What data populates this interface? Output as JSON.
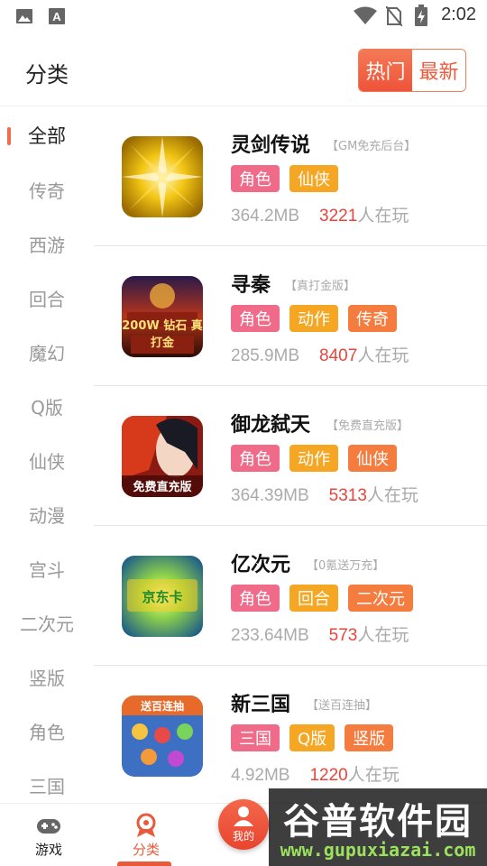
{
  "status_bar": {
    "time": "2:02",
    "icons": [
      "image-icon",
      "text-a-icon",
      "wifi-icon",
      "no-sim-icon",
      "battery-charging-icon"
    ]
  },
  "header": {
    "title": "分类",
    "toggle": {
      "hot_label": "热门",
      "new_label": "最新",
      "selected": "热门"
    }
  },
  "sidebar": {
    "items": [
      {
        "label": "全部",
        "active": true
      },
      {
        "label": "传奇",
        "active": false
      },
      {
        "label": "西游",
        "active": false
      },
      {
        "label": "回合",
        "active": false
      },
      {
        "label": "魔幻",
        "active": false
      },
      {
        "label": "Q版",
        "active": false
      },
      {
        "label": "仙侠",
        "active": false
      },
      {
        "label": "动漫",
        "active": false
      },
      {
        "label": "宫斗",
        "active": false
      },
      {
        "label": "二次元",
        "active": false
      },
      {
        "label": "竖版",
        "active": false
      },
      {
        "label": "角色",
        "active": false
      },
      {
        "label": "三国",
        "active": false
      }
    ]
  },
  "games": [
    {
      "name": "灵剑传说",
      "tagline": "【GM免充后台】",
      "tags": [
        "角色",
        "仙侠"
      ],
      "size": "364.2MB",
      "players": "3221",
      "players_suffix": "人在玩",
      "icon_text": ""
    },
    {
      "name": "寻秦",
      "tagline": "【真打金版】",
      "tags": [
        "角色",
        "动作",
        "传奇"
      ],
      "size": "285.9MB",
      "players": "8407",
      "players_suffix": "人在玩",
      "icon_text": "200W 钻石 真打金"
    },
    {
      "name": "御龙弑天",
      "tagline": "【免费直充版】",
      "tags": [
        "角色",
        "动作",
        "仙侠"
      ],
      "size": "364.39MB",
      "players": "5313",
      "players_suffix": "人在玩",
      "icon_text": "免费直充版"
    },
    {
      "name": "亿次元",
      "tagline": "【0氪送万充】",
      "tags": [
        "角色",
        "回合",
        "二次元"
      ],
      "size": "233.64MB",
      "players": "573",
      "players_suffix": "人在玩",
      "icon_text": "京东卡"
    },
    {
      "name": "新三国",
      "tagline": "【送百连抽】",
      "tags": [
        "三国",
        "Q版",
        "竖版"
      ],
      "size": "4.92MB",
      "players": "1220",
      "players_suffix": "人在玩",
      "icon_text": "送百连抽"
    }
  ],
  "bottom_nav": {
    "items": [
      {
        "label": "游戏",
        "icon": "gamepad-icon",
        "active": false
      },
      {
        "label": "分类",
        "icon": "category-icon",
        "active": true
      },
      {
        "label": "我的",
        "icon": "user-icon",
        "active": false
      }
    ]
  },
  "watermark": {
    "title": "谷普软件园",
    "url": "www.gupuxiazai.com"
  },
  "colors": {
    "accent": "#ee5a3c",
    "count_red": "#e8453c",
    "tag_pink": "#f06b8a",
    "tag_orange": "#f5a623",
    "tag_deep_orange": "#f57c3f"
  }
}
